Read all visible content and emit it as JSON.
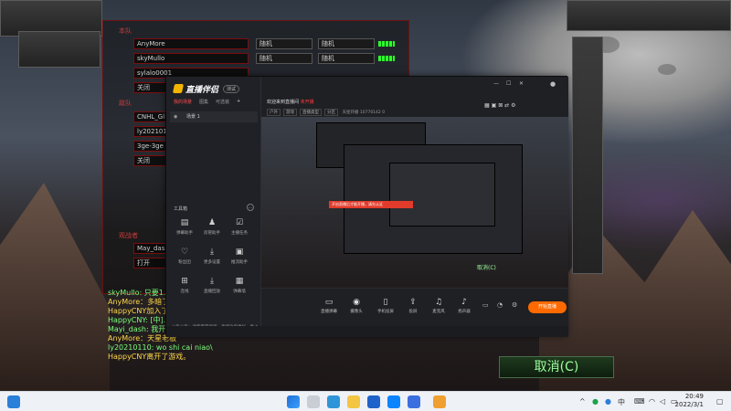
{
  "game": {
    "sections": {
      "team": "本队",
      "enemy": "敌队",
      "observer": "观战者"
    },
    "team_slots": [
      {
        "name": "AnyMore",
        "race": "随机",
        "color": "随机"
      },
      {
        "name": "skyMullo",
        "race": "随机",
        "color": "随机"
      },
      {
        "name": "sylalo0001",
        "race": "",
        "color": ""
      }
    ],
    "team_closed": "关闭",
    "enemy_slots": [
      {
        "name": "CNHL_Gl"
      },
      {
        "name": "ly202101"
      },
      {
        "name": "3ge-3ge"
      }
    ],
    "enemy_closed": "关闭",
    "observer_slots": [
      {
        "name": "May_dash"
      }
    ],
    "observer_open": "打开",
    "chat": [
      {
        "text": "skyMullo: 只要1...",
        "color": "#7cff7c"
      },
      {
        "text": "AnyMore：多暗了...",
        "color": "#ffd84a"
      },
      {
        "text": "HappyCNY加入了...",
        "color": "#ffd84a"
      },
      {
        "text": "HappyCNY: [中]...",
        "color": "#7cff7c"
      },
      {
        "text": "Mayi_dash: 我开...",
        "color": "#7cff7c"
      },
      {
        "text": "AnyMore：天星老板",
        "color": "#ffd84a"
      },
      {
        "text": "ly20210110: wo shi cai niao\\",
        "color": "#7cff7c"
      },
      {
        "text": "HappyCNY离开了游戏。",
        "color": "#ffd84a"
      }
    ],
    "cancel_label": "取消(C)"
  },
  "app": {
    "logo_text": "直播伴侣",
    "logo_badge": "测试",
    "side_tabs": [
      "我的场景",
      "图集",
      "可选装"
    ],
    "scene_label": "场景 1",
    "tools_title": "工具箱",
    "tools": [
      {
        "label": "弹幕助手",
        "icon": "▤"
      },
      {
        "label": "房管助手",
        "icon": "♟"
      },
      {
        "label": "主播任务",
        "icon": "☑"
      },
      {
        "label": "粉丝团",
        "icon": "♡"
      },
      {
        "label": "更多设置",
        "icon": "⤓"
      },
      {
        "label": "推流助手",
        "icon": "▣"
      },
      {
        "label": "连线",
        "icon": "⊞"
      },
      {
        "label": "直播回放",
        "icon": "⤓"
      },
      {
        "label": "弹幕墙",
        "icon": "▦"
      }
    ],
    "hint": "公告公告：请使用最新版，直播效果更好，更上一层楼",
    "window_title": "欢迎来到直播间",
    "title_badge": "未开播",
    "meta_chips": [
      "户外",
      "游戏",
      "直播类型",
      "分区"
    ],
    "meta_text": "天星开播   10770142   0",
    "preview_banner": "开启直播后才能开播，请先认证",
    "bottom_items": [
      {
        "label": "直播弹幕",
        "icon": "▭"
      },
      {
        "label": "摄像头",
        "icon": "◉"
      },
      {
        "label": "手机投屏",
        "icon": "▯"
      },
      {
        "label": "投屏",
        "icon": "⇪"
      },
      {
        "label": "麦克风",
        "icon": "♫"
      },
      {
        "label": "扬声器",
        "icon": "♪"
      }
    ],
    "live_button": "开始直播"
  },
  "taskbar": {
    "time": "20:49",
    "date": "2022/3/1",
    "tray_text": "中"
  }
}
